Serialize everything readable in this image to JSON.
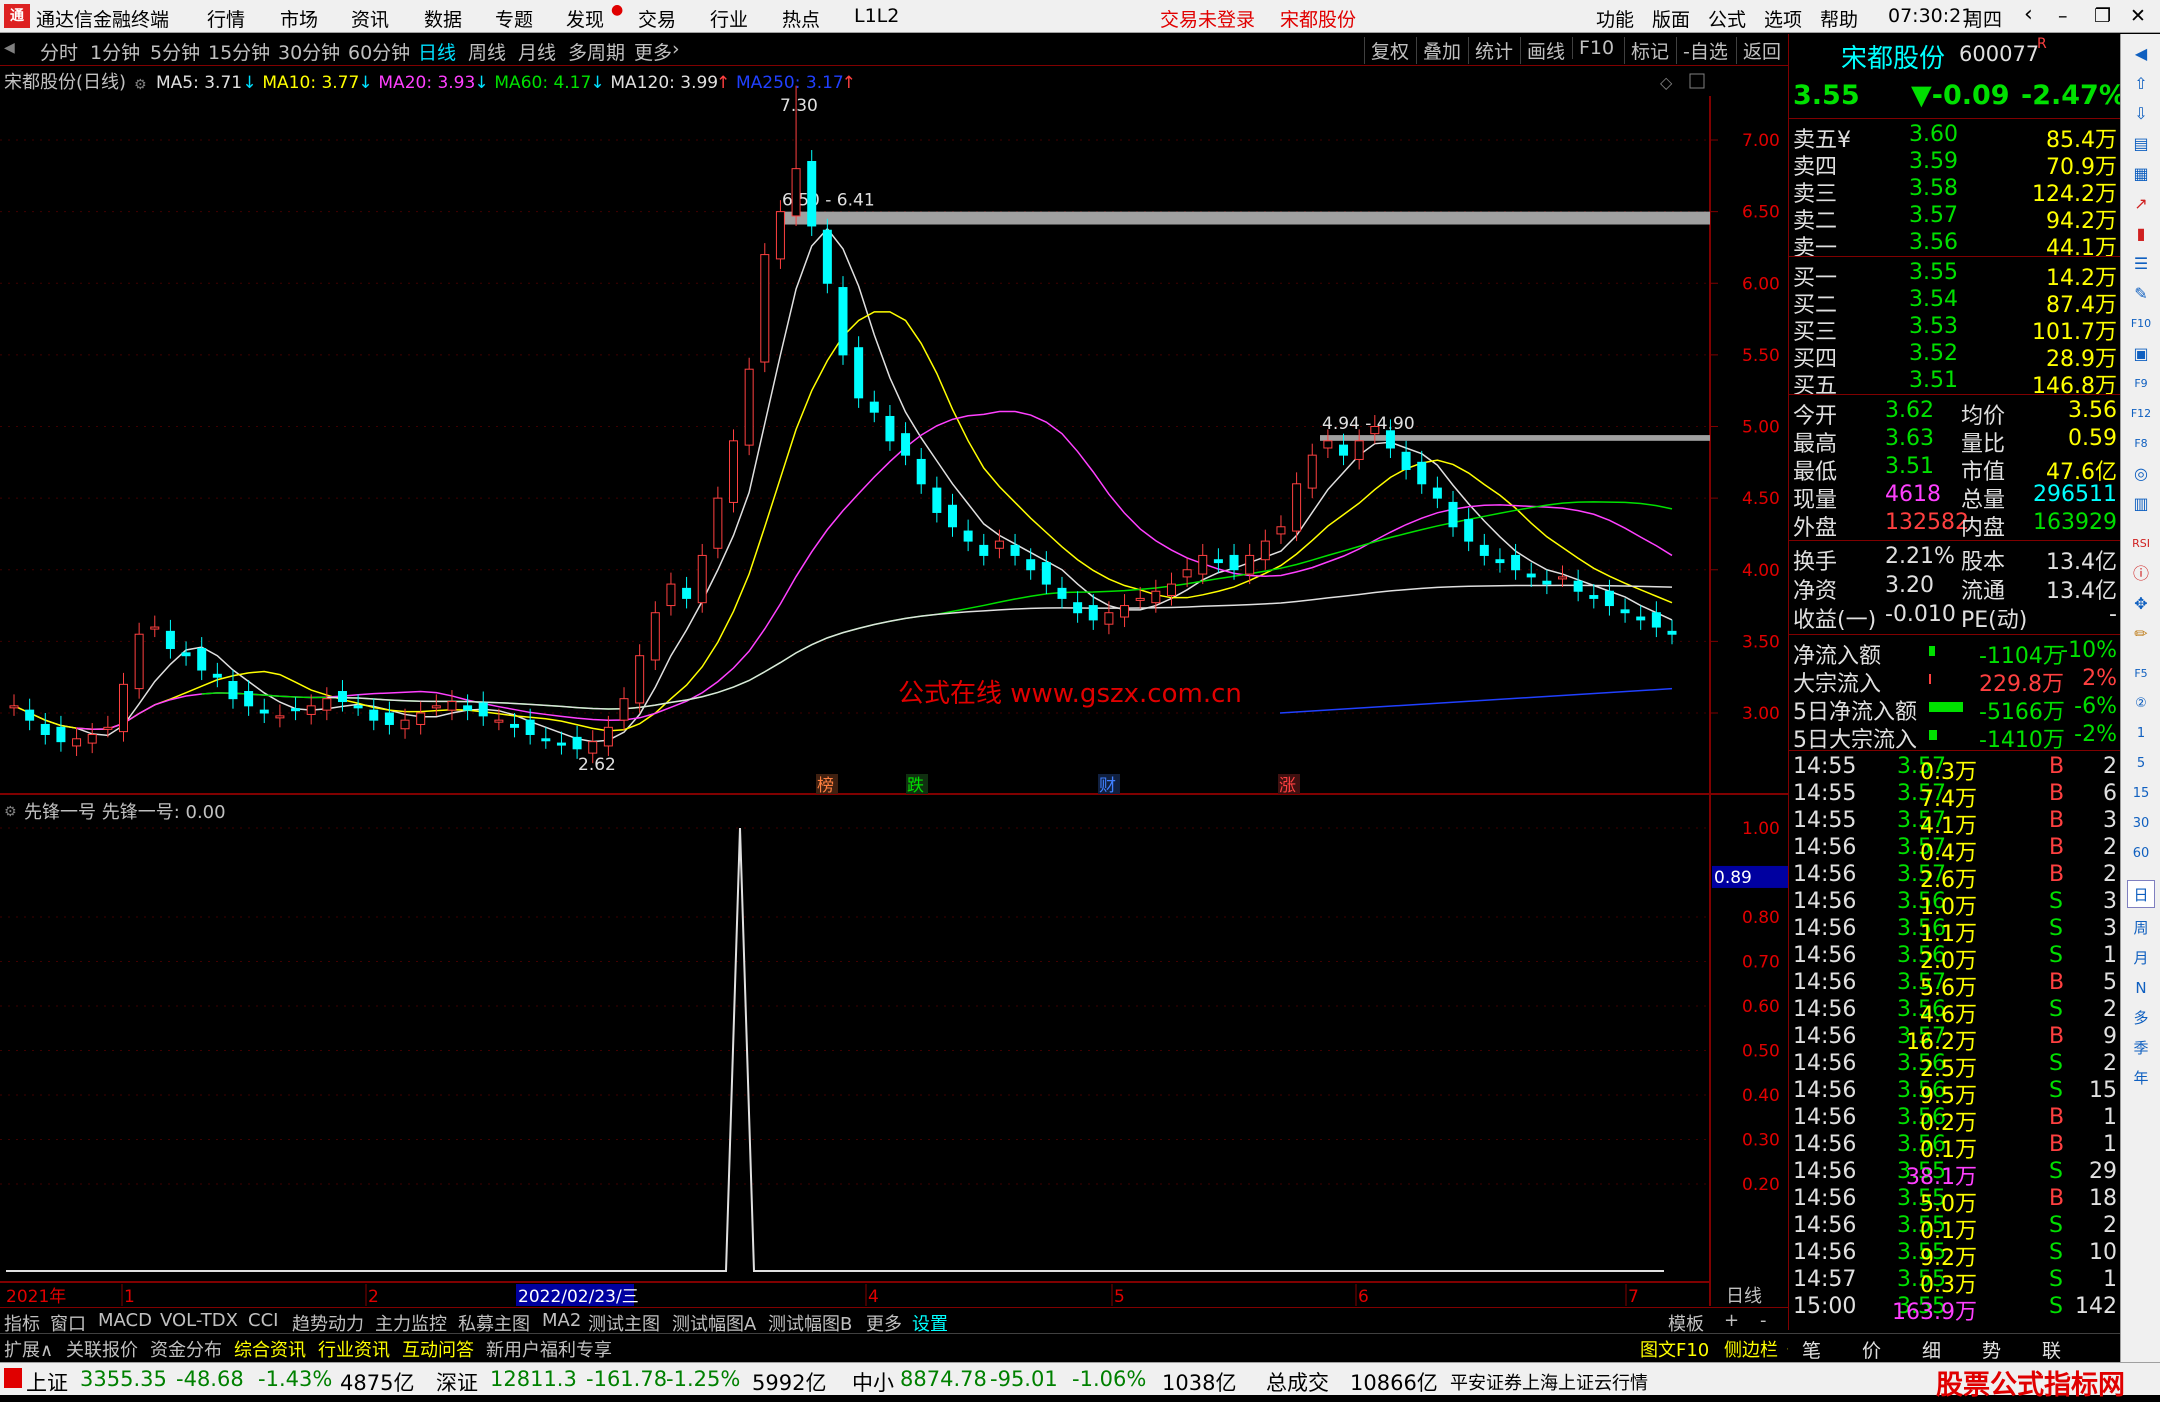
{
  "titlebar": {
    "app_name": "通达信金融终端",
    "menus": [
      "行情",
      "市场",
      "资讯",
      "数据",
      "专题",
      "发现",
      "交易",
      "行业",
      "热点",
      "L1L2"
    ],
    "status_trade": "交易未登录",
    "stock_name": "宋都股份",
    "right_menus": [
      "功能",
      "版面",
      "公式",
      "选项",
      "帮助"
    ],
    "time": "07:30:21",
    "weekday": "周四"
  },
  "toolbar": {
    "periods": [
      "分时",
      "1分钟",
      "5分钟",
      "15分钟",
      "30分钟",
      "60分钟",
      "日线",
      "周线",
      "月线",
      "多周期",
      "更多"
    ],
    "active_period": "日线",
    "right_buttons": [
      "复权",
      "叠加",
      "统计",
      "画线",
      "F10",
      "标记",
      "-自选",
      "返回"
    ]
  },
  "chart_header": {
    "title": "宋都股份(日线)",
    "ma_labels": [
      {
        "label": "MA5: 3.71",
        "arrow": "↓",
        "color": "#e0e0e0"
      },
      {
        "label": "MA10: 3.77",
        "arrow": "↓",
        "color": "#ffff00"
      },
      {
        "label": "MA20: 3.93",
        "arrow": "↓",
        "color": "#ff40ff"
      },
      {
        "label": "MA60: 4.17",
        "arrow": "↓",
        "color": "#00e000"
      },
      {
        "label": "MA120: 3.99",
        "arrow": "↑",
        "color": "#e0e0e0"
      },
      {
        "label": "MA250: 3.17",
        "arrow": "↑",
        "color": "#2040ff"
      }
    ]
  },
  "chart_data": {
    "type": "candlestick",
    "price_axis": [
      "7.00",
      "6.50",
      "6.00",
      "5.50",
      "5.00",
      "4.50",
      "4.00",
      "3.50",
      "3.00"
    ],
    "price_ticks": [
      7.0,
      6.5,
      6.0,
      5.5,
      5.0,
      4.5,
      4.0,
      3.5,
      3.0
    ],
    "annotations": {
      "high": "7.30",
      "low": "2.62",
      "zone1": "6.50 - 6.41",
      "zone2": "4.94 - 4.90"
    },
    "zone1": [
      6.5,
      6.41
    ],
    "zone2": [
      4.94,
      4.9
    ],
    "event_marks": [
      {
        "text": "榜",
        "color": "#ff8040"
      },
      {
        "text": "跌",
        "color": "#00e000"
      },
      {
        "text": "财",
        "color": "#4080ff"
      },
      {
        "text": "涨",
        "color": "#ff4040"
      }
    ],
    "watermark": "公式在线  www.gszx.com.cn",
    "indicator_title": "先锋一号  先锋一号: 0.00",
    "indicator_axis": [
      "1.00",
      "0.89",
      "0.80",
      "0.70",
      "0.60",
      "0.50",
      "0.40",
      "0.30",
      "0.20"
    ],
    "indicator_ticks": [
      1.0,
      0.89,
      0.8,
      0.7,
      0.6,
      0.5,
      0.4,
      0.3,
      0.2
    ],
    "indicator_current": "0.89",
    "indicator_spike": 1.0,
    "time_axis": [
      "2021年",
      "1",
      "2",
      "2022/02/23/三",
      "4",
      "5",
      "6",
      "7"
    ]
  },
  "quote": {
    "name": "宋都股份",
    "code": "600077",
    "flag": "R",
    "price": "3.55",
    "change": "▼-0.09",
    "pct": "-2.47%",
    "asks": [
      {
        "label": "卖五¥",
        "price": "3.60",
        "vol": "85.4万"
      },
      {
        "label": "卖四",
        "price": "3.59",
        "vol": "70.9万"
      },
      {
        "label": "卖三",
        "price": "3.58",
        "vol": "124.2万"
      },
      {
        "label": "卖二",
        "price": "3.57",
        "vol": "94.2万"
      },
      {
        "label": "卖一",
        "price": "3.56",
        "vol": "44.1万"
      }
    ],
    "bids": [
      {
        "label": "买一",
        "price": "3.55",
        "vol": "14.2万"
      },
      {
        "label": "买二",
        "price": "3.54",
        "vol": "87.4万"
      },
      {
        "label": "买三",
        "price": "3.53",
        "vol": "101.7万"
      },
      {
        "label": "买四",
        "price": "3.52",
        "vol": "28.9万"
      },
      {
        "label": "买五",
        "price": "3.51",
        "vol": "146.8万"
      }
    ],
    "stats": [
      {
        "l1": "今开",
        "v1": "3.62",
        "l2": "均价",
        "v2": "3.56"
      },
      {
        "l1": "最高",
        "v1": "3.63",
        "l2": "量比",
        "v2": "0.59"
      },
      {
        "l1": "最低",
        "v1": "3.51",
        "l2": "市值",
        "v2": "47.6亿"
      },
      {
        "l1": "现量",
        "v1": "4618",
        "l2": "总量",
        "v2": "296511"
      },
      {
        "l1": "外盘",
        "v1": "132582",
        "l2": "内盘",
        "v2": "163929"
      }
    ],
    "stats2": [
      {
        "l1": "换手",
        "v1": "2.21%",
        "l2": "股本",
        "v2": "13.4亿"
      },
      {
        "l1": "净资",
        "v1": "3.20",
        "l2": "流通",
        "v2": "13.4亿"
      },
      {
        "l1": "收益(一)",
        "v1": "-0.010",
        "l2": "PE(动)",
        "v2": "-"
      }
    ],
    "flows": [
      {
        "label": "净流入额",
        "val": "-1104万",
        "pct": "-10%"
      },
      {
        "label": "大宗流入",
        "val": "229.8万",
        "pct": "2%"
      },
      {
        "label": "5日净流入额",
        "val": "-5166万",
        "pct": "-6%"
      },
      {
        "label": "5日大宗流入",
        "val": "-1410万",
        "pct": "-2%"
      }
    ],
    "ticks": [
      [
        "14:55",
        "3.57",
        "0.3万",
        "B",
        "2"
      ],
      [
        "14:55",
        "3.57",
        "7.4万",
        "B",
        "6"
      ],
      [
        "14:55",
        "3.57",
        "4.1万",
        "B",
        "3"
      ],
      [
        "14:56",
        "3.57",
        "0.4万",
        "B",
        "2"
      ],
      [
        "14:56",
        "3.57",
        "2.6万",
        "B",
        "2"
      ],
      [
        "14:56",
        "3.56",
        "1.0万",
        "S",
        "3"
      ],
      [
        "14:56",
        "3.56",
        "1.1万",
        "S",
        "3"
      ],
      [
        "14:56",
        "3.56",
        "2.0万",
        "S",
        "1"
      ],
      [
        "14:56",
        "3.57",
        "5.6万",
        "B",
        "5"
      ],
      [
        "14:56",
        "3.56",
        "4.6万",
        "S",
        "2"
      ],
      [
        "14:56",
        "3.57",
        "16.2万",
        "B",
        "9"
      ],
      [
        "14:56",
        "3.56",
        "2.5万",
        "S",
        "2"
      ],
      [
        "14:56",
        "3.56",
        "9.5万",
        "S",
        "15"
      ],
      [
        "14:56",
        "3.56",
        "0.2万",
        "B",
        "1"
      ],
      [
        "14:56",
        "3.56",
        "0.1万",
        "B",
        "1"
      ],
      [
        "14:56",
        "3.55",
        "38.1万",
        "S",
        "29"
      ],
      [
        "14:56",
        "3.55",
        "5.0万",
        "B",
        "18"
      ],
      [
        "14:56",
        "3.55",
        "0.1万",
        "S",
        "2"
      ],
      [
        "14:56",
        "3.55",
        "9.2万",
        "S",
        "10"
      ],
      [
        "14:57",
        "3.55",
        "0.3万",
        "S",
        "1"
      ],
      [
        "15:00",
        "3.55",
        "163.9万",
        "S",
        "142"
      ]
    ],
    "bottom_tabs": [
      "笔",
      "价",
      "细",
      "势",
      "联"
    ]
  },
  "bottom_tabs": {
    "tabs": [
      "指标",
      "窗口",
      "MACD",
      "VOL-TDX",
      "CCI",
      "趋势动力",
      "主力监控",
      "私募主图",
      "MA2",
      "测试主图",
      "测试幅图A",
      "测试幅图B",
      "更多",
      "设置"
    ],
    "right": [
      "模板",
      "+",
      "-"
    ],
    "right_label": "日线"
  },
  "bottom_bar2": {
    "items": [
      "扩展∧",
      "关联报价",
      "资金分布",
      "综合资讯",
      "行业资讯",
      "互动问答",
      "新用户福利专享"
    ],
    "right": [
      "图文F10",
      "侧边栏《"
    ]
  },
  "statusbar": {
    "sh_name": "上证",
    "sh_val": "3355.35",
    "sh_chg": "-48.68",
    "sh_pct": "-1.43%",
    "sh_amt": "4875亿",
    "sz_name": "深证",
    "sz_val": "12811.3",
    "sz_chg": "-161.78",
    "sz_pct": "-1.25%",
    "sz_amt": "5992亿",
    "zx_name": "中小",
    "zx_val": "8874.78",
    "zx_chg": "-95.01",
    "zx_pct": "-1.06%",
    "zx_amt": "1038亿",
    "total_label": "总成交",
    "total_val": "10866亿",
    "broker": "平安证券上海上证云行情",
    "brand": "股票公式指标网"
  }
}
